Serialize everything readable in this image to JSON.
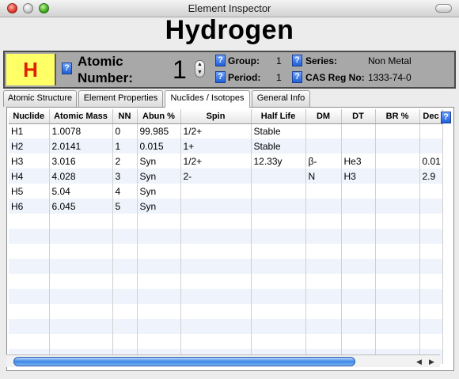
{
  "window": {
    "title": "Element Inspector"
  },
  "element": {
    "name": "Hydrogen",
    "symbol": "H",
    "atomic_number_label": "Atomic Number:",
    "atomic_number": "1",
    "group_label": "Group:",
    "group": "1",
    "period_label": "Period:",
    "period": "1",
    "series_label": "Series:",
    "series": "Non Metal",
    "cas_label": "CAS Reg No:",
    "cas": "1333-74-0",
    "help_glyph": "?"
  },
  "tabs": [
    {
      "label": "Atomic Structure"
    },
    {
      "label": "Element Properties"
    },
    {
      "label": "Nuclides / Isotopes"
    },
    {
      "label": "General Info"
    }
  ],
  "table": {
    "headers": [
      "Nuclide",
      "Atomic Mass",
      "NN",
      "Abun %",
      "Spin",
      "Half Life",
      "DM",
      "DT",
      "BR %",
      "Dec"
    ],
    "rows": [
      [
        "H1",
        "1.0078",
        "0",
        "99.985",
        "1/2+",
        "Stable",
        "",
        "",
        "",
        ""
      ],
      [
        "H2",
        "2.0141",
        "1",
        "0.015",
        "1+",
        "Stable",
        "",
        "",
        "",
        ""
      ],
      [
        "H3",
        "3.016",
        "2",
        "Syn",
        "1/2+",
        "12.33y",
        "β-",
        "He3",
        "",
        "0.01"
      ],
      [
        "H4",
        "4.028",
        "3",
        "Syn",
        "2-",
        "",
        "N",
        "H3",
        "",
        "2.9"
      ],
      [
        "H5",
        "5.04",
        "4",
        "Syn",
        "",
        "",
        "",
        "",
        "",
        ""
      ],
      [
        "H6",
        "6.045",
        "5",
        "Syn",
        "",
        "",
        "",
        "",
        "",
        ""
      ]
    ]
  }
}
